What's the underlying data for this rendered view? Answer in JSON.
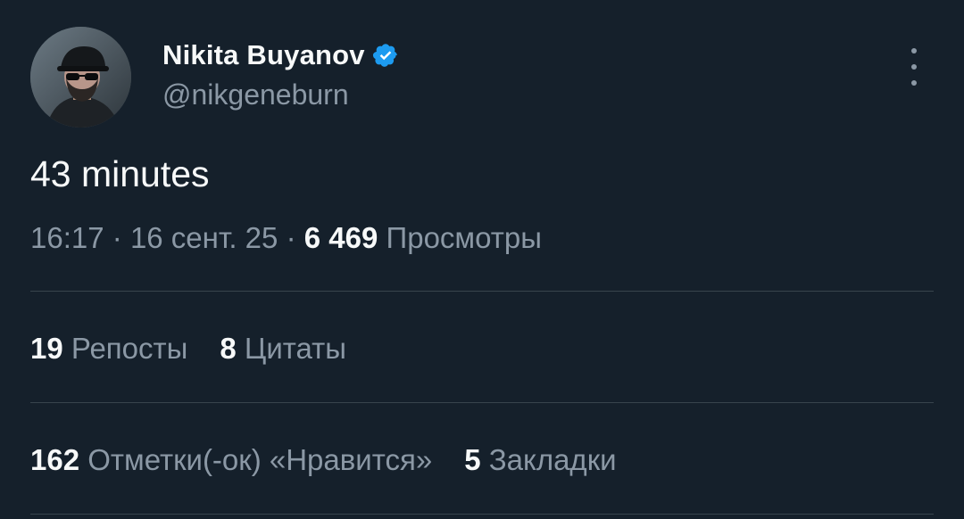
{
  "author": {
    "display_name": "Nikita Buyanov",
    "handle": "@nikgeneburn",
    "verified_color": "#1d9bf0"
  },
  "tweet": {
    "text": "43 minutes",
    "time": "16:17",
    "date": "16 сент. 25",
    "separator": "·",
    "views_count": "6 469",
    "views_label": "Просмотры"
  },
  "stats": {
    "reposts_count": "19",
    "reposts_label": "Репосты",
    "quotes_count": "8",
    "quotes_label": "Цитаты",
    "likes_count": "162",
    "likes_label": "Отметки(-ок) «Нравится»",
    "bookmarks_count": "5",
    "bookmarks_label": "Закладки"
  },
  "icons": {
    "verified": "verified-badge-icon",
    "more": "more-options-icon"
  },
  "colors": {
    "background": "#15202b",
    "text_primary": "#f7f9f9",
    "text_secondary": "#8b98a5",
    "divider": "#38444d",
    "accent": "#1d9bf0"
  }
}
